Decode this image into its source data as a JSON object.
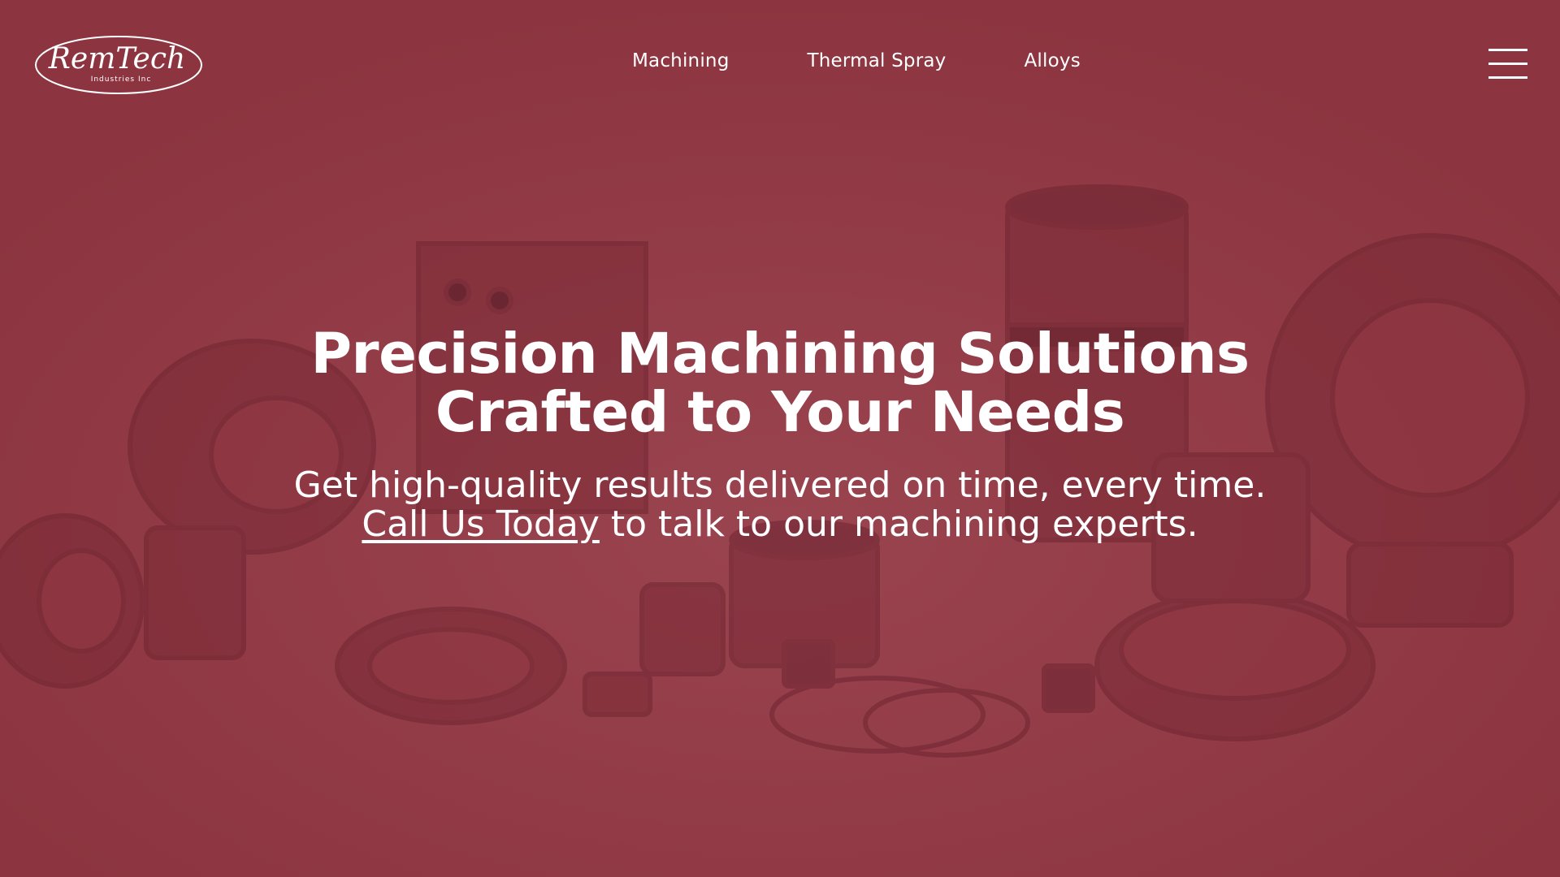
{
  "brand": {
    "logo_main": "RemTech",
    "logo_sub": "Industries Inc"
  },
  "nav": {
    "items": [
      {
        "label": "Machining"
      },
      {
        "label": "Thermal Spray"
      },
      {
        "label": "Alloys"
      }
    ]
  },
  "menu": {
    "icon": "hamburger-icon"
  },
  "hero": {
    "headline_line1": "Precision Machining Solutions",
    "headline_line2": "Crafted to Your Needs",
    "subline_line1": "Get high-quality results delivered on time, every time.",
    "cta_link": "Call Us Today",
    "subline_line2_rest": " to talk to our machining experts."
  },
  "colors": {
    "overlay": "#8c3540",
    "text": "#ffffff"
  }
}
